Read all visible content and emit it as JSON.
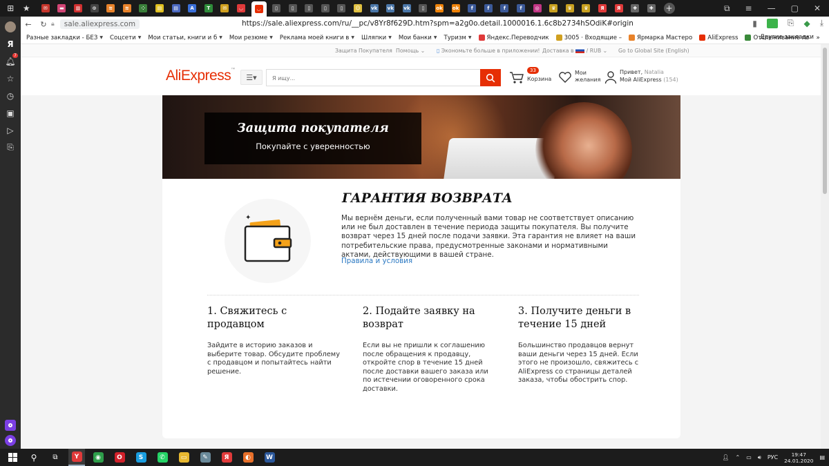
{
  "browser": {
    "tabs": [
      {
        "icon": "gmail-icon",
        "color": "#c5362c",
        "glyph": "✉"
      },
      {
        "icon": "flag-icon",
        "color": "#d24575",
        "glyph": "▬"
      },
      {
        "icon": "chart-icon",
        "color": "#d03030",
        "glyph": "▥"
      },
      {
        "icon": "compass-icon",
        "color": "#444",
        "glyph": "⊙"
      },
      {
        "icon": "rss-icon",
        "color": "#e8822a",
        "glyph": "≋"
      },
      {
        "icon": "rss-icon",
        "color": "#e8822a",
        "glyph": "≋"
      },
      {
        "icon": "apps-icon",
        "color": "#3a7f3a",
        "glyph": "⁘"
      },
      {
        "icon": "note-icon",
        "color": "#e0c020",
        "glyph": "▤"
      },
      {
        "icon": "doc-icon",
        "color": "#4a68c0",
        "glyph": "▤"
      },
      {
        "icon": "translate-icon",
        "color": "#3a6fd8",
        "glyph": "A"
      },
      {
        "icon": "t-icon",
        "color": "#2e8b3a",
        "glyph": "T"
      },
      {
        "icon": "mail-icon",
        "color": "#d0a020",
        "glyph": "✉"
      },
      {
        "icon": "pocket-icon",
        "color": "#e03a3a",
        "glyph": "◡"
      },
      {
        "icon": "aliexpress-tab-icon",
        "color": "#e62e04",
        "glyph": "◡",
        "active": true
      },
      {
        "icon": "page-icon",
        "color": "#555",
        "glyph": "▯"
      },
      {
        "icon": "page-icon",
        "color": "#555",
        "glyph": "▯"
      },
      {
        "icon": "page-icon",
        "color": "#555",
        "glyph": "▯"
      },
      {
        "icon": "page-icon",
        "color": "#555",
        "glyph": "▯"
      },
      {
        "icon": "page-icon",
        "color": "#555",
        "glyph": "▯"
      },
      {
        "icon": "emoji-icon",
        "color": "#e0c040",
        "glyph": "☺"
      },
      {
        "icon": "vk-icon",
        "color": "#4a76a8",
        "glyph": "vk"
      },
      {
        "icon": "vk-icon",
        "color": "#4a76a8",
        "glyph": "vk"
      },
      {
        "icon": "vk-icon",
        "color": "#4a76a8",
        "glyph": "vk"
      },
      {
        "icon": "page-icon",
        "color": "#555",
        "glyph": "▯"
      },
      {
        "icon": "odnoklassniki-icon",
        "color": "#ee8208",
        "glyph": "ok"
      },
      {
        "icon": "odnoklassniki-icon",
        "color": "#ee8208",
        "glyph": "ok"
      },
      {
        "icon": "facebook-icon",
        "color": "#3b5998",
        "glyph": "f"
      },
      {
        "icon": "facebook-icon",
        "color": "#3b5998",
        "glyph": "f"
      },
      {
        "icon": "facebook-icon",
        "color": "#3b5998",
        "glyph": "f"
      },
      {
        "icon": "facebook-icon",
        "color": "#3b5998",
        "glyph": "f"
      },
      {
        "icon": "instagram-icon",
        "color": "#c13584",
        "glyph": "◎"
      },
      {
        "icon": "crown-icon",
        "color": "#c8a020",
        "glyph": "♛"
      },
      {
        "icon": "crown-icon",
        "color": "#c8a020",
        "glyph": "♛"
      },
      {
        "icon": "crown-icon",
        "color": "#c8a020",
        "glyph": "♛"
      },
      {
        "icon": "yandex-icon",
        "color": "#e03a3a",
        "glyph": "Я"
      },
      {
        "icon": "yandex-icon",
        "color": "#e03a3a",
        "glyph": "Я"
      },
      {
        "icon": "plus-icon",
        "color": "#666",
        "glyph": "✚"
      },
      {
        "icon": "plus-icon",
        "color": "#666",
        "glyph": "✚"
      }
    ],
    "address": {
      "domain": "sale.aliexpress.com",
      "url": "https://sale.aliexpress.com/ru/__pc/v8Yr8f629D.htm?spm=a2g0o.detail.1000016.1.6c8b2734hSOdiK#origin"
    },
    "bookmarks": [
      {
        "label": "Разные закладки - БЕЗ",
        "folder": true,
        "color": ""
      },
      {
        "label": "Соцсети",
        "folder": true,
        "color": ""
      },
      {
        "label": "Мои статьи, книги и б",
        "folder": true,
        "color": ""
      },
      {
        "label": "Мои резюме",
        "folder": true,
        "color": ""
      },
      {
        "label": "Реклама моей книги в",
        "folder": true,
        "color": ""
      },
      {
        "label": "Шляпки",
        "folder": true,
        "color": ""
      },
      {
        "label": "Мои банки",
        "folder": true,
        "color": ""
      },
      {
        "label": "Туризм",
        "folder": true,
        "color": ""
      },
      {
        "label": "Яндекс.Переводчик",
        "folder": false,
        "color": "#e03a3a"
      },
      {
        "label": "3005 · Входящие –",
        "folder": false,
        "color": "#d0a020"
      },
      {
        "label": "Ярмарка Мастеро",
        "folder": false,
        "color": "#e8822a"
      },
      {
        "label": "AliExpress",
        "folder": false,
        "color": "#e62e04"
      },
      {
        "label": "Отслеживание по",
        "folder": false,
        "color": "#3a8a3a"
      }
    ],
    "bookmarks_more": "»",
    "bookmarks_other": "Другие закладки"
  },
  "sidebar": {
    "notification_count": "7"
  },
  "site": {
    "topinfo": {
      "buyer_protection": "Защита Покупателя",
      "help": "Помощь",
      "app_promo": "Экономьте больше в приложении!",
      "ship_to": "Доставка в",
      "currency": "RUB",
      "global": "Go to Global Site (English)"
    },
    "logo": "AliExpress",
    "search_placeholder": "Я ищу...",
    "cart": {
      "count": "33",
      "label": "Корзина"
    },
    "wishlist": {
      "line1": "Мои",
      "line2": "желания"
    },
    "account": {
      "greeting": "Привет,",
      "name": "Natalia",
      "my": "Мой AliExpress",
      "count": "(154)"
    },
    "banner": {
      "title": "Защита покупателя",
      "subtitle": "Покупайте с уверенностью"
    },
    "guarantee": {
      "title": "ГАРАНТИЯ ВОЗВРАТА",
      "body": "Мы вернём деньги, если полученный вами товар не соответствует описанию или не был доставлен в течение периода защиты покупателя. Вы получите возврат через 15 дней после подачи заявки. Эта гарантия не влияет на ваши потребительские права, предусмотренные законами и нормативными актами, действующими в вашей стране.",
      "link": "Правила и условия"
    },
    "steps": [
      {
        "title": "1. Свяжитесь с продавцом",
        "text": "Зайдите в историю заказов и выберите товар. Обсудите проблему с продавцом и попытайтесь найти решение."
      },
      {
        "title": "2. Подайте заявку на возврат",
        "text": "Если вы не пришли к соглашению после обращения к продавцу, откройте спор в течение 15 дней после доставки вашего заказа или по истечении оговоренного срока доставки."
      },
      {
        "title": "3. Получите деньги в течение 15 дней",
        "text": "Большинство продавцов вернут ваши деньги через 15 дней. Если этого не произошло, свяжитесь с AliExpress со страницы деталей заказа, чтобы обострить спор."
      }
    ],
    "colors": {
      "accent": "#e62e04",
      "link": "#2a78c2"
    }
  },
  "taskbar": {
    "apps": [
      {
        "name": "yandex-browser-icon",
        "glyph": "Y",
        "color": "#e03a3a",
        "active": true
      },
      {
        "name": "chrome-icon",
        "glyph": "◉",
        "color": "#2e9e4a",
        "active": false
      },
      {
        "name": "opera-icon",
        "glyph": "O",
        "color": "#d0202a",
        "active": false
      },
      {
        "name": "skype-icon",
        "glyph": "S",
        "color": "#1a9ee0",
        "active": false
      },
      {
        "name": "whatsapp-icon",
        "glyph": "✆",
        "color": "#25d366",
        "active": false
      },
      {
        "name": "file-explorer-icon",
        "glyph": "▭",
        "color": "#e8b830",
        "active": false
      },
      {
        "name": "pinned-app-icon",
        "glyph": "✎",
        "color": "#6a8a9a",
        "active": false
      },
      {
        "name": "yandex-icon",
        "glyph": "Я",
        "color": "#e03a3a",
        "active": false
      },
      {
        "name": "firefox-icon",
        "glyph": "◐",
        "color": "#e8702a",
        "active": false
      },
      {
        "name": "word-icon",
        "glyph": "W",
        "color": "#2b579a",
        "active": false
      }
    ],
    "language": "РУС",
    "time": "19:47",
    "date": "24.01.2020"
  }
}
